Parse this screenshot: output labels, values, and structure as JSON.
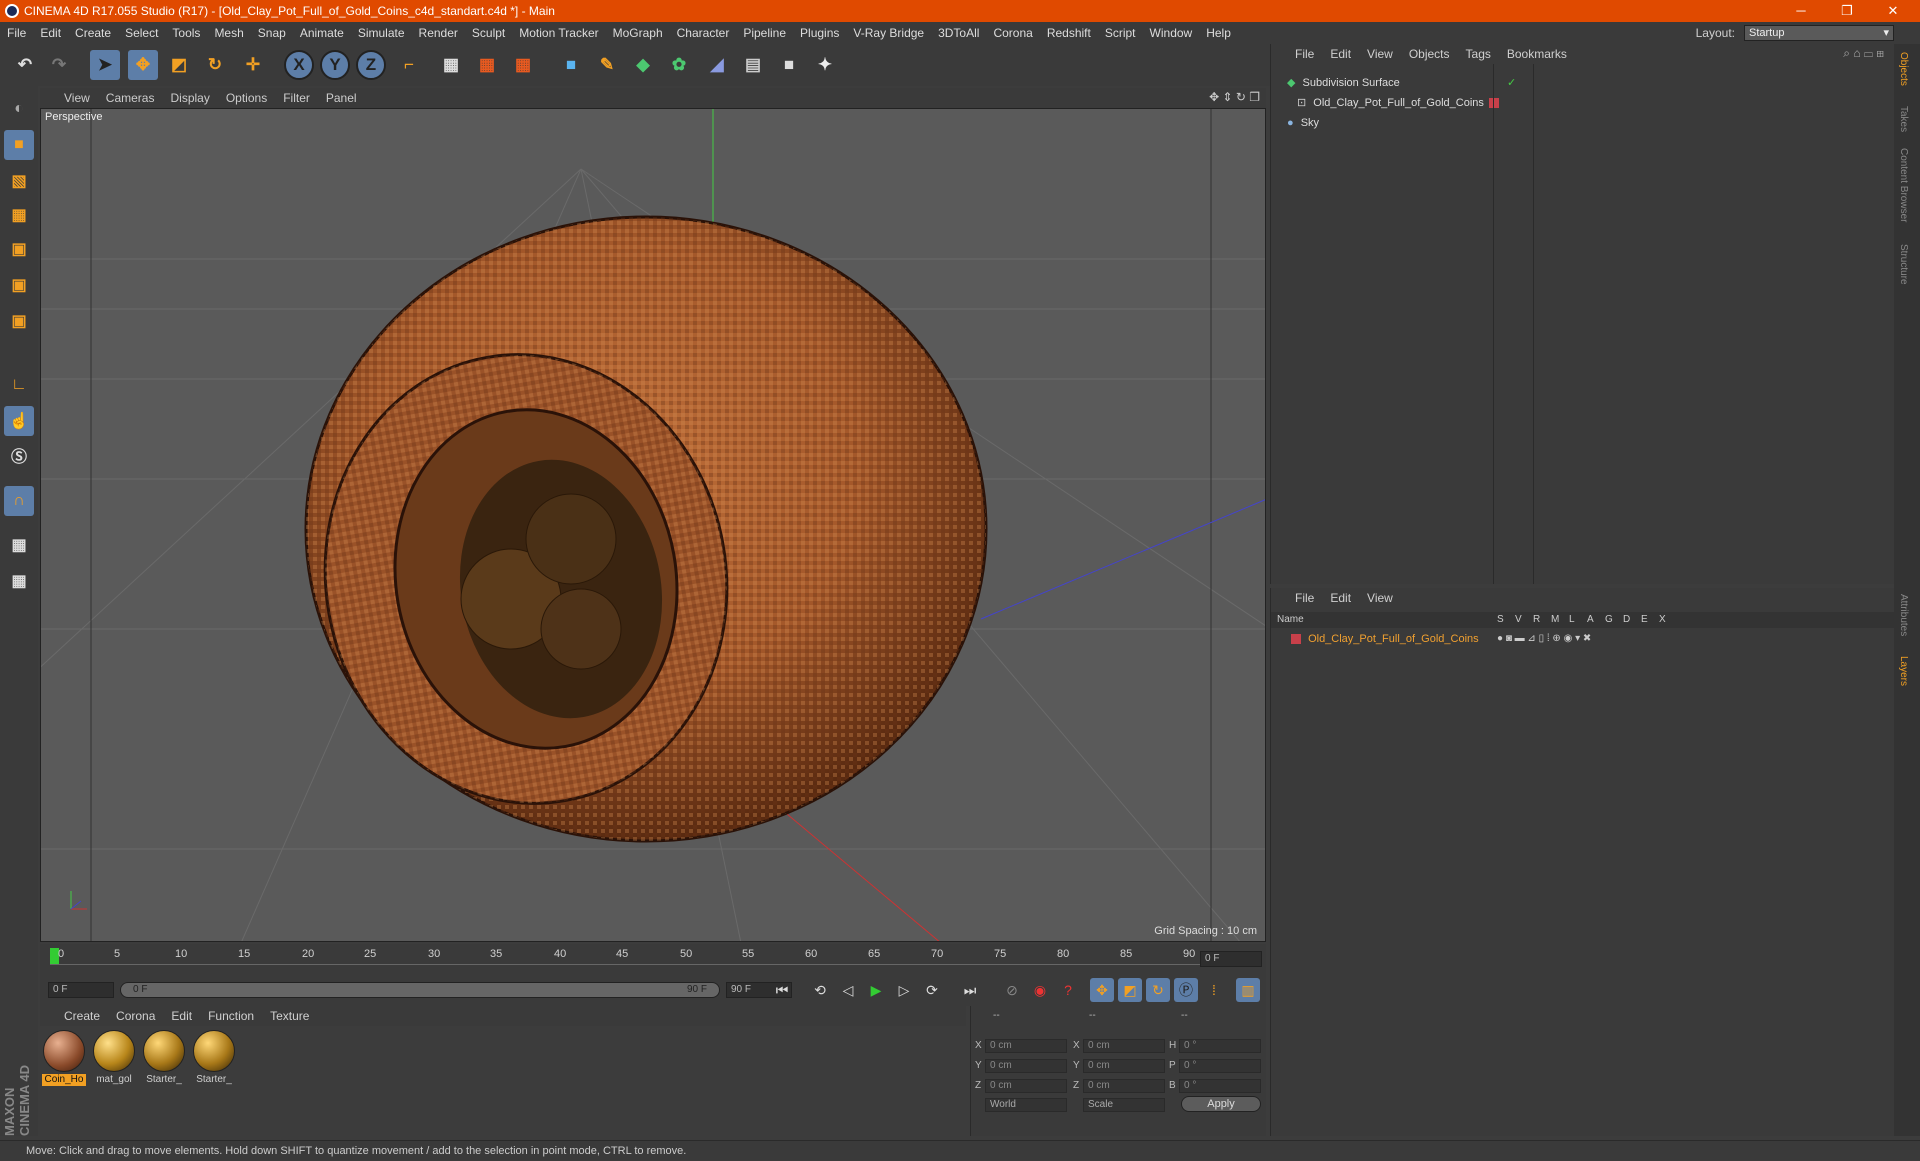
{
  "window": {
    "title": "CINEMA 4D R17.055 Studio (R17) - [Old_Clay_Pot_Full_of_Gold_Coins_c4d_standart.c4d *] - Main",
    "minimize": "─",
    "restore": "❐",
    "close": "✕"
  },
  "menubar": {
    "items": [
      "File",
      "Edit",
      "Create",
      "Select",
      "Tools",
      "Mesh",
      "Snap",
      "Animate",
      "Simulate",
      "Render",
      "Sculpt",
      "Motion Tracker",
      "MoGraph",
      "Character",
      "Pipeline",
      "Plugins",
      "V-Ray Bridge",
      "3DToAll",
      "Corona",
      "Redshift",
      "Script",
      "Window",
      "Help"
    ],
    "layout_label": "Layout:",
    "layout_value": "Startup"
  },
  "toolbar": {
    "axis_x": "X",
    "axis_y": "Y",
    "axis_z": "Z"
  },
  "viewport": {
    "menu": [
      "View",
      "Cameras",
      "Display",
      "Options",
      "Filter",
      "Panel"
    ],
    "label": "Perspective",
    "grid_spacing": "Grid Spacing : 10 cm"
  },
  "timeline": {
    "ticks": [
      "0",
      "5",
      "10",
      "15",
      "20",
      "25",
      "30",
      "35",
      "40",
      "45",
      "50",
      "55",
      "60",
      "65",
      "70",
      "75",
      "80",
      "85",
      "90"
    ],
    "current_frame": "0 F",
    "start_field": "0 F",
    "range_start": "0 F",
    "range_end": "90 F",
    "end_field": "90 F"
  },
  "materials": {
    "menu": [
      "Create",
      "Corona",
      "Edit",
      "Function",
      "Texture"
    ],
    "items": [
      {
        "name": "Coin_Ho",
        "color": "#8a4a2a"
      },
      {
        "name": "mat_gol",
        "color": "#b8861a"
      },
      {
        "name": "Starter_",
        "color": "#a87818"
      },
      {
        "name": "Starter_",
        "color": "#a87818"
      }
    ]
  },
  "coords": {
    "header": [
      "--",
      "--",
      "--"
    ],
    "rows": [
      {
        "a": "X",
        "a_val": "0 cm",
        "b": "X",
        "b_val": "0 cm",
        "c": "H",
        "c_val": "0 °"
      },
      {
        "a": "Y",
        "a_val": "0 cm",
        "b": "Y",
        "b_val": "0 cm",
        "c": "P",
        "c_val": "0 °"
      },
      {
        "a": "Z",
        "a_val": "0 cm",
        "b": "Z",
        "b_val": "0 cm",
        "c": "B",
        "c_val": "0 °"
      }
    ],
    "world": "World",
    "scale": "Scale",
    "apply": "Apply"
  },
  "objects": {
    "menu": [
      "File",
      "Edit",
      "View",
      "Objects",
      "Tags",
      "Bookmarks"
    ],
    "items": [
      "Subdivision Surface",
      "Old_Clay_Pot_Full_of_Gold_Coins",
      "Sky"
    ]
  },
  "layers": {
    "menu": [
      "File",
      "Edit",
      "View"
    ],
    "header_name": "Name",
    "columns": [
      "S",
      "V",
      "R",
      "M",
      "L",
      "A",
      "G",
      "D",
      "E",
      "X"
    ],
    "items": [
      "Old_Clay_Pot_Full_of_Gold_Coins"
    ]
  },
  "sidetabs": [
    "Objects",
    "Takes",
    "Content Browser",
    "Structure",
    "Attributes",
    "Layers"
  ],
  "status": "Move: Click and drag to move elements. Hold down SHIFT to quantize movement / add to the selection in point mode, CTRL to remove.",
  "brand": "MAXON CINEMA 4D",
  "colors": {
    "accent": "#e04a00",
    "layer_text": "#f0a030",
    "layer_swatch": "#c8404a"
  }
}
